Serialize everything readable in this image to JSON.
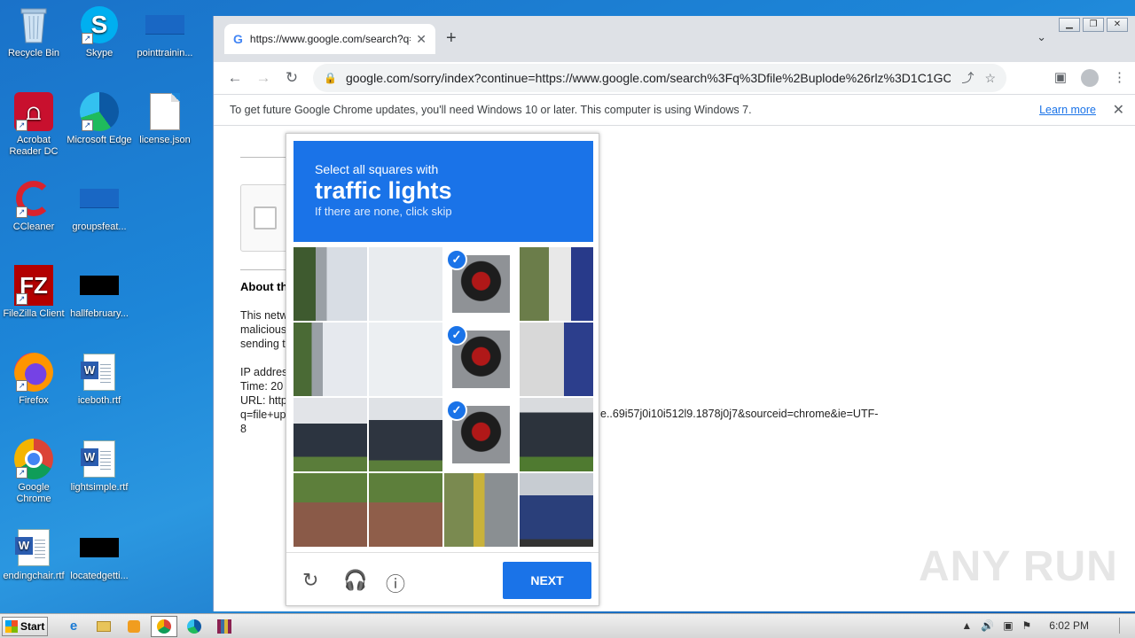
{
  "desktop": {
    "icons": [
      {
        "label": "Recycle Bin"
      },
      {
        "label": "Skype"
      },
      {
        "label": "pointtrainin..."
      },
      {
        "label": "Acrobat Reader DC"
      },
      {
        "label": "Microsoft Edge"
      },
      {
        "label": "license.json"
      },
      {
        "label": "CCleaner"
      },
      {
        "label": "groupsfeat..."
      },
      {
        "label": "FileZilla Client"
      },
      {
        "label": "hallfebruary..."
      },
      {
        "label": "Firefox"
      },
      {
        "label": "iceboth.rtf"
      },
      {
        "label": "Google Chrome"
      },
      {
        "label": "lightsimple.rtf"
      },
      {
        "label": "endingchair.rtf"
      },
      {
        "label": "locatedgetti..."
      }
    ]
  },
  "browser": {
    "tab_title": "https://www.google.com/search?q=",
    "address": "google.com/sorry/index?continue=https://www.google.com/search%3Fq%3Dfile%2Buplode%26rlz%3D1C1GCEA_...",
    "infobar_text": "To get future Google Chrome updates, you'll need Windows 10 or later. This computer is using Windows 7.",
    "infobar_link": "Learn more"
  },
  "page": {
    "about_heading": "About th",
    "para1": [
      "This netw",
      "malicious",
      "sending t"
    ],
    "ip_lines": [
      "IP addres",
      "Time: 20",
      "URL: http",
      "q=file+up",
      "8"
    ],
    "url_tail": "e..69i57j0i10i512l9.1878j0j7&sourceid=chrome&ie=UTF-"
  },
  "captcha": {
    "line1": "Select all squares with",
    "target": "traffic lights",
    "line3": "If there are none, click skip",
    "selected_tiles": [
      2,
      6,
      10
    ],
    "next_label": "NEXT"
  },
  "taskbar": {
    "start_label": "Start",
    "clock": "6:02 PM"
  },
  "watermark": "ANY RUN"
}
